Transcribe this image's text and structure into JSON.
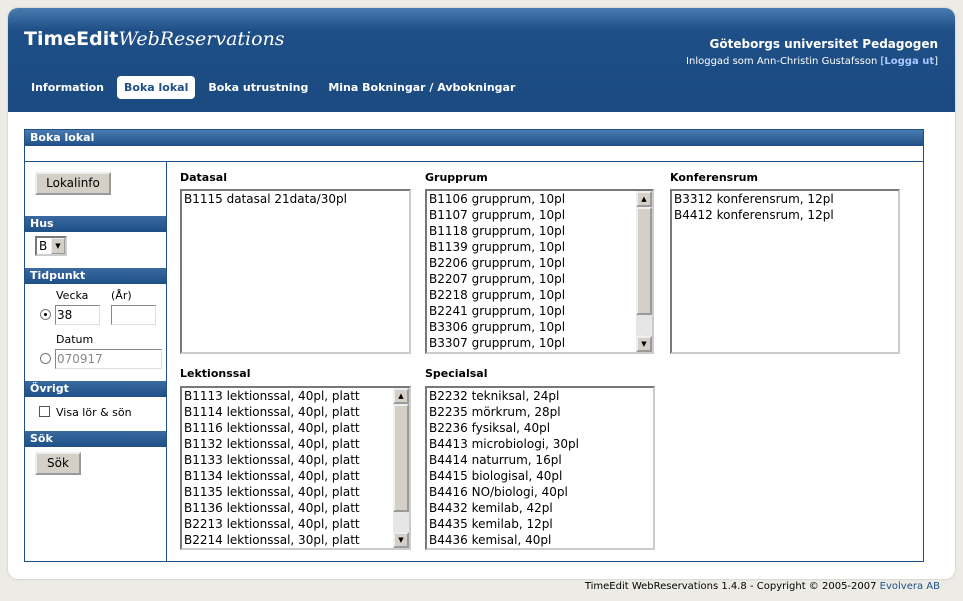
{
  "header": {
    "logo_main": "TimeEdit",
    "logo_sub": "WebReservations",
    "org": "Göteborgs universitet Pedagogen",
    "login_prefix": "Inloggad som Ann-Christin Gustafsson [",
    "logout": "Logga ut",
    "login_suffix": "]"
  },
  "nav": [
    {
      "label": "Information"
    },
    {
      "label": "Boka lokal",
      "active": true
    },
    {
      "label": "Boka utrustning"
    },
    {
      "label": "Mina Bokningar / Avbokningar"
    }
  ],
  "box_title": "Boka lokal",
  "sidebar": {
    "lokalinfo": "Lokalinfo",
    "hus_title": "Hus",
    "hus_value": "B",
    "tidpunkt_title": "Tidpunkt",
    "vecka_label": "Vecka",
    "ar_label": "(År)",
    "vecka_value": "38",
    "ar_value": "",
    "datum_label": "Datum",
    "datum_value": "070917",
    "ovrigt_title": "Övrigt",
    "visa_label": "Visa lör & sön",
    "visa_checked": false,
    "sok_title": "Sök",
    "sok_button": "Sök"
  },
  "groups": {
    "datasal": {
      "title": "Datasal",
      "items": [
        "B1115 datasal 21data/30pl"
      ]
    },
    "grupprum": {
      "title": "Grupprum",
      "items": [
        "B1106 grupprum, 10pl",
        "B1107 grupprum, 10pl",
        "B1118 grupprum, 10pl",
        "B1139 grupprum, 10pl",
        "B2206 grupprum, 10pl",
        "B2207 grupprum, 10pl",
        "B2218 grupprum, 10pl",
        "B2241 grupprum, 10pl",
        "B3306 grupprum, 10pl",
        "B3307 grupprum, 10pl"
      ]
    },
    "konferensrum": {
      "title": "Konferensrum",
      "items": [
        "B3312 konferensrum, 12pl",
        "B4412 konferensrum, 12pl"
      ]
    },
    "lektionssal": {
      "title": "Lektionssal",
      "items": [
        "B1113 lektionssal, 40pl, platt",
        "B1114 lektionssal, 40pl, platt",
        "B1116 lektionssal, 40pl, platt",
        "B1132 lektionssal, 40pl, platt",
        "B1133 lektionssal, 40pl, platt",
        "B1134 lektionssal, 40pl, platt",
        "B1135 lektionssal, 40pl, platt",
        "B1136 lektionssal, 40pl, platt",
        "B2213 lektionssal, 40pl, platt",
        "B2214 lektionssal, 30pl, platt"
      ]
    },
    "specialsal": {
      "title": "Specialsal",
      "items": [
        "B2232 tekniksal, 24pl",
        "B2235 mörkrum, 28pl",
        "B2236 fysiksal, 40pl",
        "B4413 microbiologi, 30pl",
        "B4414 naturrum, 16pl",
        "B4415 biologisal, 40pl",
        "B4416 NO/biologi, 40pl",
        "B4432 kemilab, 42pl",
        "B4435 kemilab, 12pl",
        "B4436 kemisal, 40pl"
      ]
    }
  },
  "footer": {
    "text": "TimeEdit WebReservations 1.4.8 - Copyright © 2005-2007",
    "link": "Evolvera AB"
  },
  "colors": {
    "brand": "#1e4f86"
  }
}
